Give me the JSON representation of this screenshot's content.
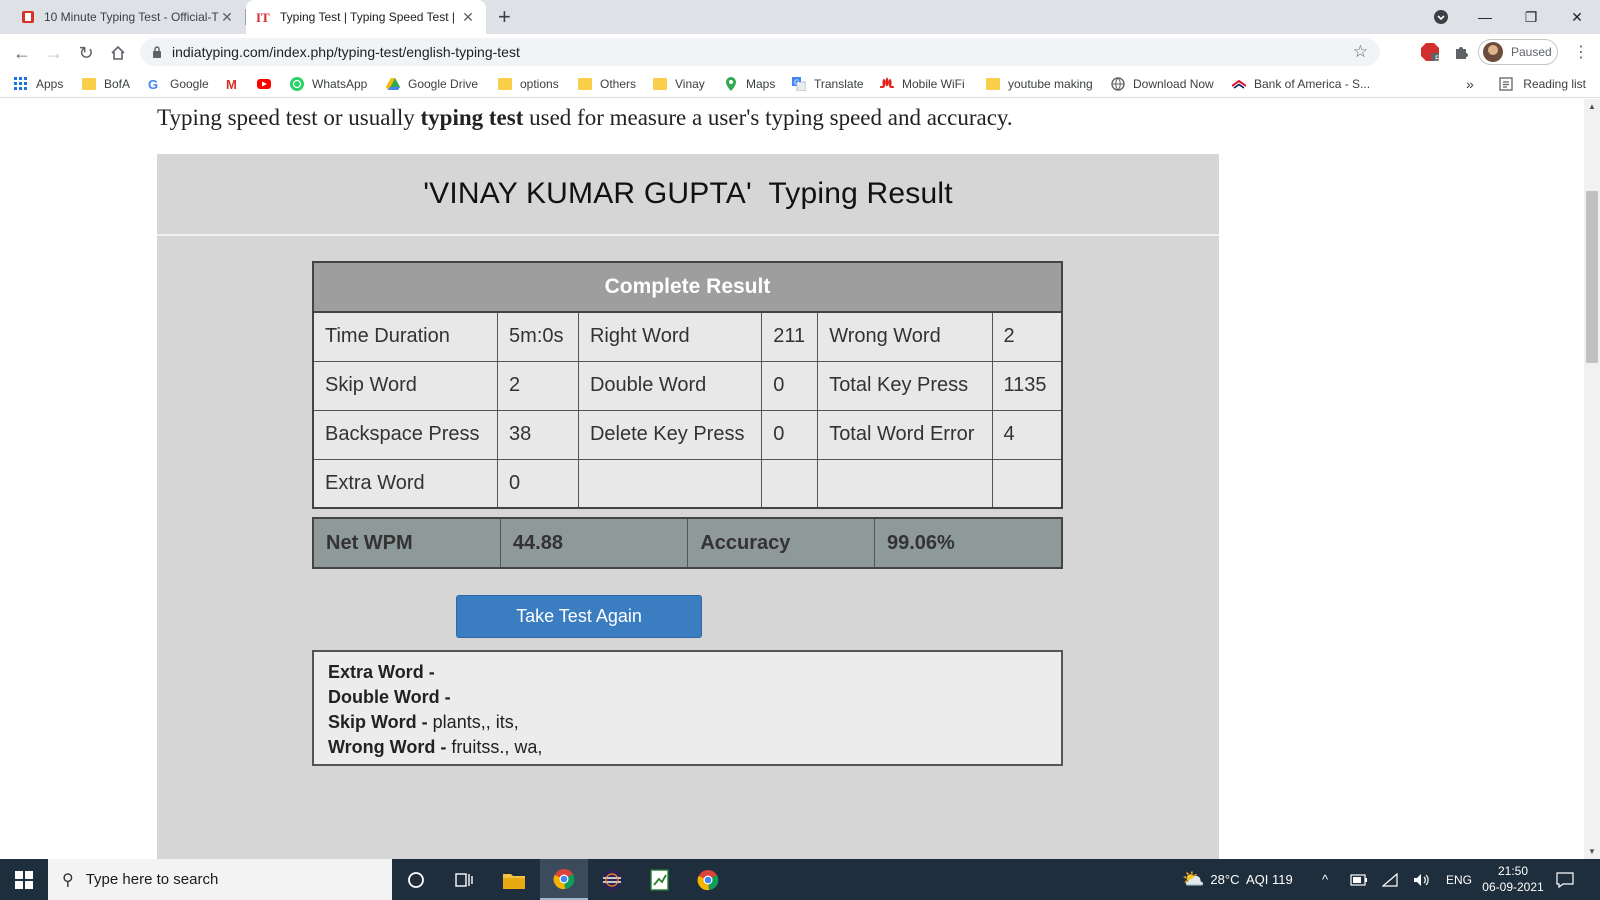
{
  "browser": {
    "tabs": [
      {
        "title": "10 Minute Typing Test - Official-T",
        "active": false
      },
      {
        "title": "Typing Test | Typing Speed Test |",
        "active": true
      }
    ],
    "url": "indiatyping.com/index.php/typing-test/english-typing-test",
    "profile_label": "Paused",
    "extension_badge": "5",
    "bookmarks": [
      "Apps",
      "BofA",
      "Google",
      "WhatsApp",
      "Google Drive",
      "options",
      "Others",
      "Vinay",
      "Maps",
      "Translate",
      "Mobile WiFi",
      "youtube making",
      "Download Now",
      "Bank of America - S..."
    ],
    "reading_list": "Reading list",
    "more_bookmarks": "»"
  },
  "page": {
    "intro_pre": "Typing speed test or usually ",
    "intro_bold": "typing test",
    "intro_post": " used for measure a user's typing speed and accuracy.",
    "result_title": "'VINAY KUMAR GUPTA'  Typing Result",
    "table_header": "Complete Result",
    "rows": [
      [
        {
          "label": "Time Duration",
          "value": "5m:0s"
        },
        {
          "label": "Right Word",
          "value": "211"
        },
        {
          "label": "Wrong Word",
          "value": "2"
        }
      ],
      [
        {
          "label": "Skip Word",
          "value": "2"
        },
        {
          "label": "Double Word",
          "value": "0"
        },
        {
          "label": "Total Key Press",
          "value": "1135"
        }
      ],
      [
        {
          "label": "Backspace Press",
          "value": "38"
        },
        {
          "label": "Delete Key Press",
          "value": "0"
        },
        {
          "label": "Total Word Error",
          "value": "4"
        }
      ],
      [
        {
          "label": "Extra Word",
          "value": "0"
        },
        {
          "label": "",
          "value": ""
        },
        {
          "label": "",
          "value": ""
        }
      ]
    ],
    "summary": {
      "net_wpm_label": "Net WPM",
      "net_wpm": "44.88",
      "accuracy_label": "Accuracy",
      "accuracy": "99.06%"
    },
    "button_label": "Take Test Again",
    "details": [
      {
        "label": "Extra Word -",
        "value": ""
      },
      {
        "label": "Double Word -",
        "value": ""
      },
      {
        "label": "Skip Word -",
        "value": " plants,, its,"
      },
      {
        "label": "Wrong Word -",
        "value": " fruitss., wa,"
      }
    ]
  },
  "taskbar": {
    "search_placeholder": "Type here to search",
    "weather": "28°C  AQI 119",
    "language": "ENG",
    "time": "21:50",
    "date": "06-09-2021"
  },
  "colors": {
    "panel_bg": "#d6d6d6",
    "table_header_bg": "#9e9e9e",
    "summary_bg": "#8e9999",
    "button_bg": "#3a7dc1",
    "taskbar_bg": "#1f2e3c"
  }
}
